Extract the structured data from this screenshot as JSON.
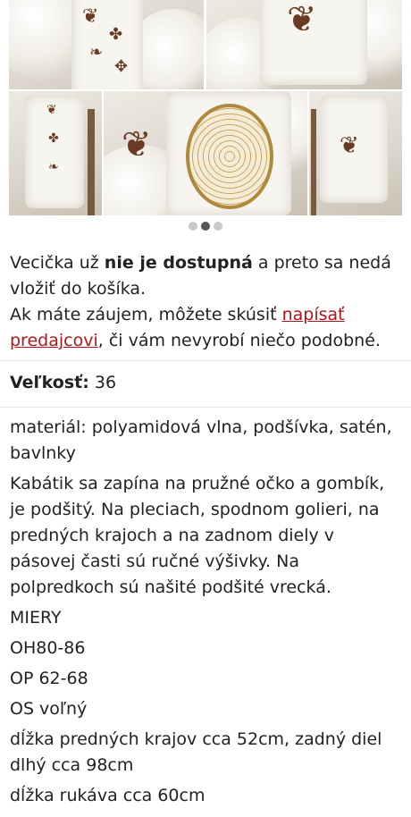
{
  "gallery": {
    "active_index": 1,
    "count": 3,
    "photos": [
      {
        "icon": "coat-detail-photo"
      },
      {
        "icon": "coat-back-detail-photo"
      },
      {
        "icon": "coat-front-photo"
      },
      {
        "icon": "coat-embroidery-photo"
      },
      {
        "icon": "coat-back-photo"
      }
    ]
  },
  "notice": {
    "part1": "Vecička už ",
    "bold": "nie je dostupná",
    "part2": " a preto sa nedá vložiť do košíka.",
    "part3": "Ak máte záujem, môžete skúsiť ",
    "link": "napísať predajcovi",
    "part4": ", či vám nevyrobí niečo podobné."
  },
  "size": {
    "label": "Veľkosť:",
    "value": " 36"
  },
  "description": [
    "materiál: polyamidová vlna, podšívka, satén, bavlnky",
    "Kabátik sa zapína na pružné očko a gombík, je podšitý. Na pleciach, spodnom golieri, na predných krajoch a na zadnom diely v pásovej časti sú ručné výšivky. Na polpredkoch sú našité podšité vrecká.",
    "MIERY",
    "OH80-86",
    "OP 62-68",
    "OS voľný",
    "dĺžka predných krajov cca 52cm, zadný diel dlhý cca 98cm",
    "dĺžka rukáva cca 60cm"
  ],
  "colors": {
    "link": "#b5121b",
    "text": "#222222",
    "dot_active": "#555555",
    "dot_inactive": "#c9c9c9"
  }
}
